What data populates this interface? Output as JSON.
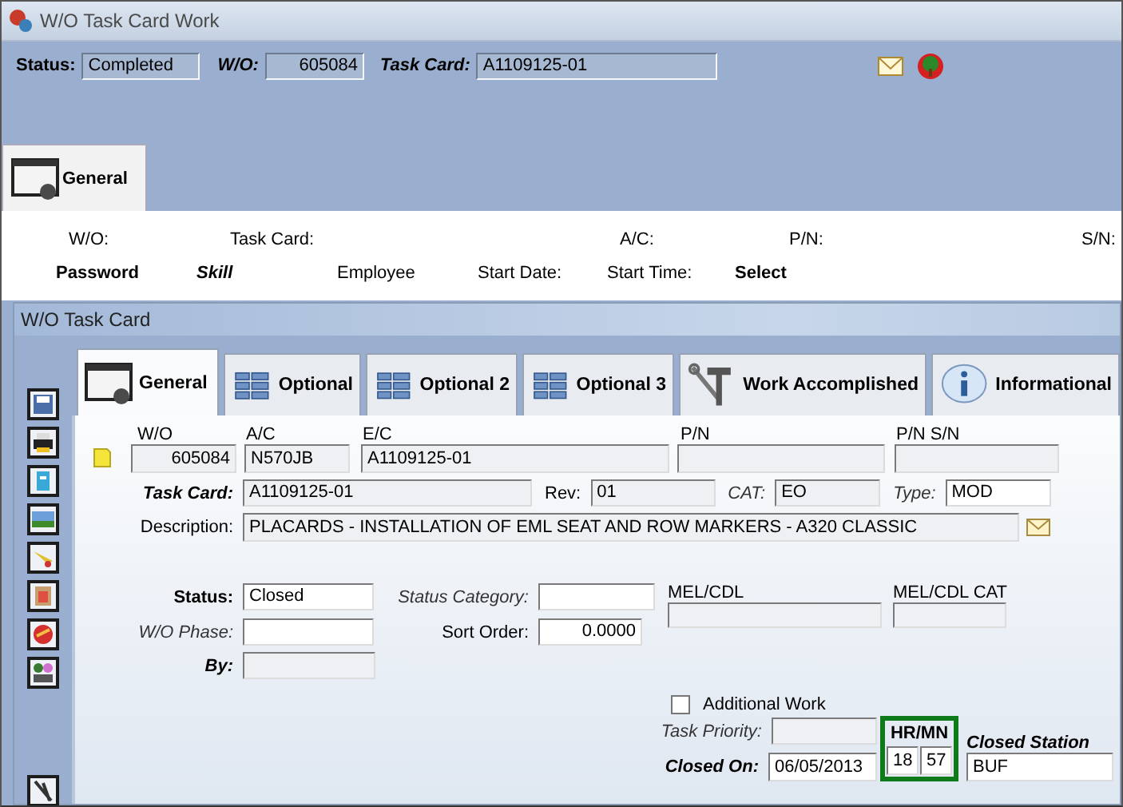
{
  "window": {
    "title": "W/O Task Card Work"
  },
  "header": {
    "status": {
      "label": "Status:",
      "value": "Completed"
    },
    "work_order": {
      "label": "W/O:",
      "value": "605084"
    },
    "task_card": {
      "label": "Task Card:",
      "value": "A1109125-01"
    }
  },
  "outer_tabs": [
    {
      "label": "General",
      "selected": true
    }
  ],
  "summary": {
    "row_1": [
      "W/O:",
      "Task Card:",
      "A/C:",
      "P/N:",
      "S/N:"
    ],
    "row_2": [
      "Password",
      "Skill",
      "Employee",
      "Start Date:",
      "Start Time:",
      "Select"
    ]
  },
  "task_card_window": {
    "title": "W/O Task Card",
    "tabs": [
      {
        "label": "General",
        "selected": true,
        "kind": "window"
      },
      {
        "label": "Optional",
        "selected": false,
        "kind": "list"
      },
      {
        "label": "Optional 2",
        "selected": false,
        "kind": "list"
      },
      {
        "label": "Optional 3",
        "selected": false,
        "kind": "list"
      },
      {
        "label": "Work Accomplished",
        "selected": false,
        "kind": "tools"
      },
      {
        "label": "Informational",
        "selected": false,
        "kind": "info"
      }
    ],
    "form": {
      "work_order": {
        "label": "W/O",
        "value": "605084",
        "disabled": true
      },
      "aircraft": {
        "label": "A/C",
        "value": "N570JB",
        "disabled": true
      },
      "engineering_code": {
        "label": "E/C",
        "value": "A1109125-01",
        "disabled": true
      },
      "part_number": {
        "label": "P/N",
        "disabled": true
      },
      "part_serial": {
        "label": "P/N S/N",
        "disabled": true
      },
      "task_card": {
        "label": "Task Card:",
        "value": "A1109125-01",
        "disabled": true
      },
      "revision": {
        "label": "Rev:",
        "value": "01",
        "disabled": true
      },
      "category": {
        "label": "CAT:",
        "value": "EO",
        "disabled": true
      },
      "type": {
        "label": "Type:",
        "value": "MOD",
        "disabled": false
      },
      "description": {
        "label": "Description:",
        "value": "PLACARDS - INSTALLATION OF EML SEAT AND ROW MARKERS - A320 CLASSIC",
        "disabled": true
      },
      "status": {
        "label": "Status:",
        "value": "Closed",
        "disabled": false
      },
      "status_category": {
        "label": "Status Category:",
        "disabled": false
      },
      "wo_phase": {
        "label": "W/O Phase:",
        "disabled": false
      },
      "sort_order": {
        "label": "Sort Order:",
        "value": "0.0000",
        "disabled": false
      },
      "by": {
        "label": "By:",
        "disabled": true
      },
      "mel_cdl": {
        "label": "MEL/CDL",
        "disabled": true
      },
      "mel_cdl_category": {
        "label": "MEL/CDL CAT",
        "disabled": true
      },
      "additional_work": {
        "label": "Additional Work",
        "checked": false
      },
      "task_priority": {
        "label": "Task Priority:",
        "disabled": true
      },
      "closed_on": {
        "label": "Closed On:",
        "value": "06/05/2013",
        "disabled": false
      },
      "closed_time": {
        "label": "HR/MN",
        "hours": "18",
        "minutes": "57"
      },
      "closed_station": {
        "label": "Closed Station",
        "value": "BUF",
        "disabled": false
      }
    }
  }
}
